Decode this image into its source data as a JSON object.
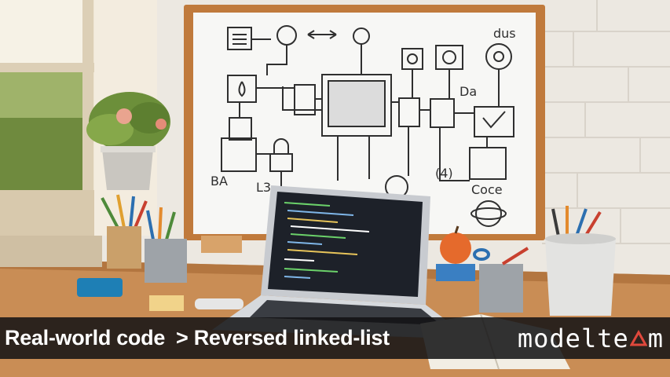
{
  "caption": {
    "topic": "Real-world code",
    "title": "> Reversed linked-list"
  },
  "brand": {
    "part1": "modelte",
    "part2": "m",
    "accent_color": "#e0483c"
  },
  "whiteboard": {
    "notes": [
      "dus",
      "Da",
      "Coce",
      "BA",
      "L3",
      "(4)"
    ]
  },
  "colors": {
    "wall": "#ece8e1",
    "desk": "#c98d55",
    "frame": "#c07a3c",
    "screen": "#1d2129",
    "caption_bg": "#121214"
  }
}
